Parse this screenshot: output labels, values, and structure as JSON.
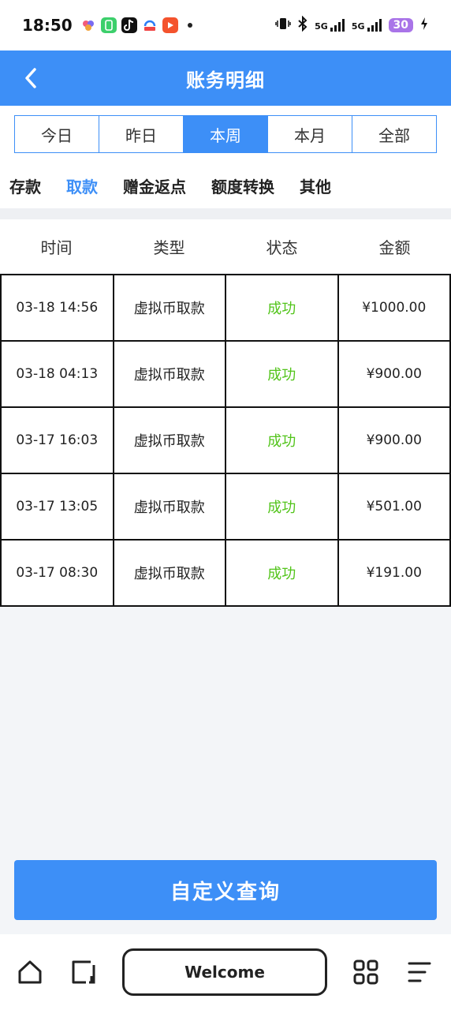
{
  "status_bar": {
    "time": "18:50",
    "signal_1": "5G",
    "signal_2": "5G",
    "battery": "30"
  },
  "header": {
    "title": "账务明细"
  },
  "date_tabs": [
    {
      "label": "今日",
      "active": false
    },
    {
      "label": "昨日",
      "active": false
    },
    {
      "label": "本周",
      "active": true
    },
    {
      "label": "本月",
      "active": false
    },
    {
      "label": "全部",
      "active": false
    }
  ],
  "category_tabs": [
    {
      "label": "存款",
      "active": false
    },
    {
      "label": "取款",
      "active": true
    },
    {
      "label": "赠金返点",
      "active": false
    },
    {
      "label": "额度转换",
      "active": false
    },
    {
      "label": "其他",
      "active": false
    }
  ],
  "table": {
    "columns": [
      "时间",
      "类型",
      "状态",
      "金额"
    ],
    "rows": [
      {
        "time": "03-18 14:56",
        "type": "虚拟币取款",
        "status": "成功",
        "amount": "¥1000.00"
      },
      {
        "time": "03-18 04:13",
        "type": "虚拟币取款",
        "status": "成功",
        "amount": "¥900.00"
      },
      {
        "time": "03-17 16:03",
        "type": "虚拟币取款",
        "status": "成功",
        "amount": "¥900.00"
      },
      {
        "time": "03-17 13:05",
        "type": "虚拟币取款",
        "status": "成功",
        "amount": "¥501.00"
      },
      {
        "time": "03-17 08:30",
        "type": "虚拟币取款",
        "status": "成功",
        "amount": "¥191.00"
      }
    ]
  },
  "query_button": {
    "label": "自定义查询"
  },
  "bottom_nav": {
    "welcome_label": "Welcome"
  },
  "colors": {
    "accent": "#3d8ff7",
    "success": "#52c41a"
  }
}
